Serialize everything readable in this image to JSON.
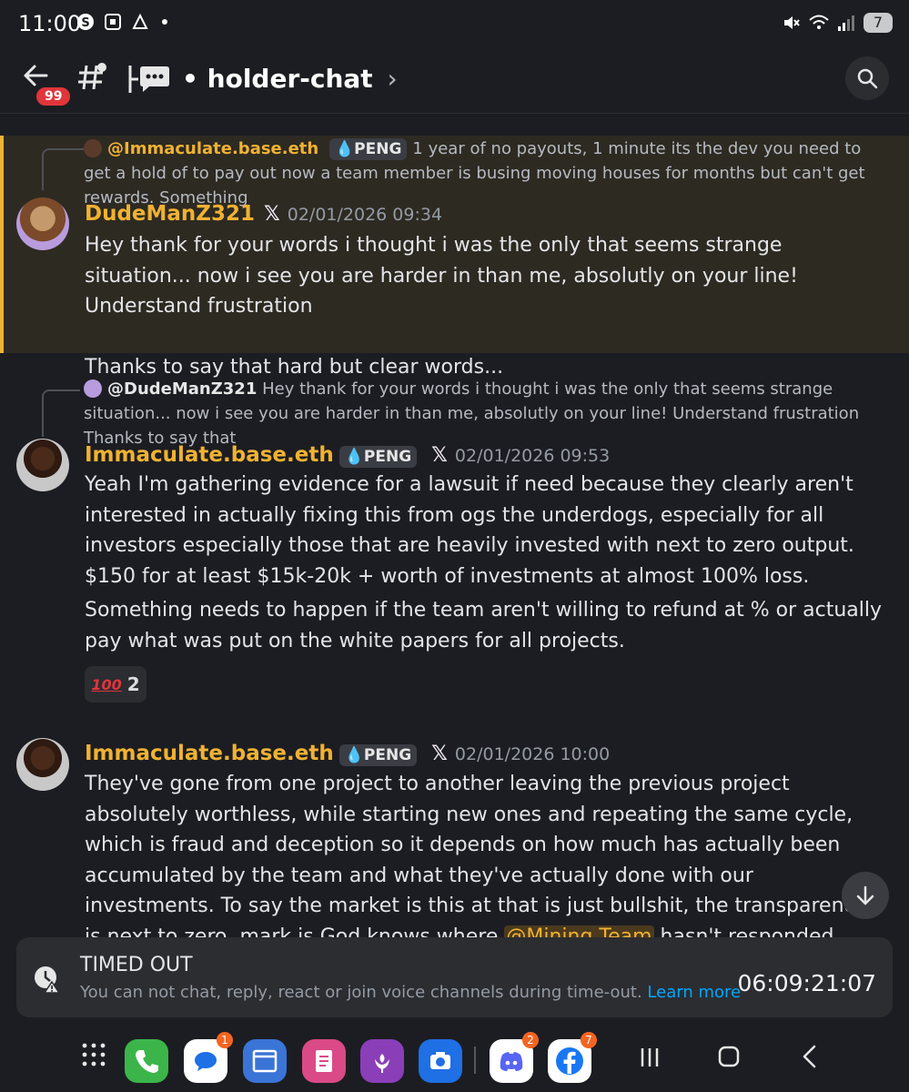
{
  "status_bar": {
    "time": "11:00",
    "battery": "7"
  },
  "header": {
    "back_badge": "99",
    "channel_name": "• holder-chat",
    "chevron": "›"
  },
  "messages": [
    {
      "reply": {
        "username": "@Immaculate.base.eth",
        "tag": "PENG",
        "text": "1 year of no payouts, 1 minute its the dev you need to get a hold of to pay out now a team member is busing moving houses for months but can't get rewards.  Something"
      },
      "author": "DudeManZ321",
      "timestamp": "02/01/2026 09:34",
      "paragraphs": [
        "Hey thank for your words i thought i was the only that seems strange situation... now i see you are harder in than me, absolutly on your line! Understand frustration",
        "Thanks to say that hard but clear words..."
      ]
    },
    {
      "reply": {
        "username": "@DudeManZ321",
        "text": "Hey thank for your words i thought i was the only that seems strange situation... now i see you are harder in than me, absolutly on your line! Understand frustration  Thanks to say that"
      },
      "author": "Immaculate.base.eth",
      "tag": "PENG",
      "timestamp": "02/01/2026 09:53",
      "paragraphs": [
        "Yeah I'm gathering evidence for a lawsuit if need because they clearly aren't interested in actually fixing this from ogs the underdogs, especially for all investors especially those that are heavily invested with next to zero output. $150 for at least $15k-20k + worth of investments at almost 100% loss.",
        "Something needs to happen if the team aren't willing to refund at % or actually pay what was put on the white papers for all projects."
      ],
      "reaction": {
        "emoji": "💯",
        "emoji_label": "100",
        "count": "2"
      }
    },
    {
      "author": "Immaculate.base.eth",
      "tag": "PENG",
      "timestamp": "02/01/2026 10:00",
      "text_before_mention": "They've gone from one project to another leaving the previous project absolutely worthless, while starting new ones and repeating the same cycle, which is fraud and deception so it depends on how much has actually been accumulated by the team and what they've actually done with our investments. To say the market is this at that is just bullshit, the transparency is next to zero, mark is God knows where ",
      "mention": "@Mining Team",
      "text_after_mention": " hasn't responded"
    }
  ],
  "timeout_banner": {
    "title": "TIMED OUT",
    "description": "You can not chat, reply, react or join voice channels during time-out.",
    "link": "Learn more",
    "timer": "06:09:21:07"
  },
  "nav_bar": {
    "messages_badge": "1",
    "discord_badge": "2",
    "facebook_badge": "7"
  },
  "colors": {
    "accent_username": "#f0b232",
    "background": "#1c1d22",
    "highlight_bg": "#2d2a22",
    "link": "#00a8fc"
  }
}
